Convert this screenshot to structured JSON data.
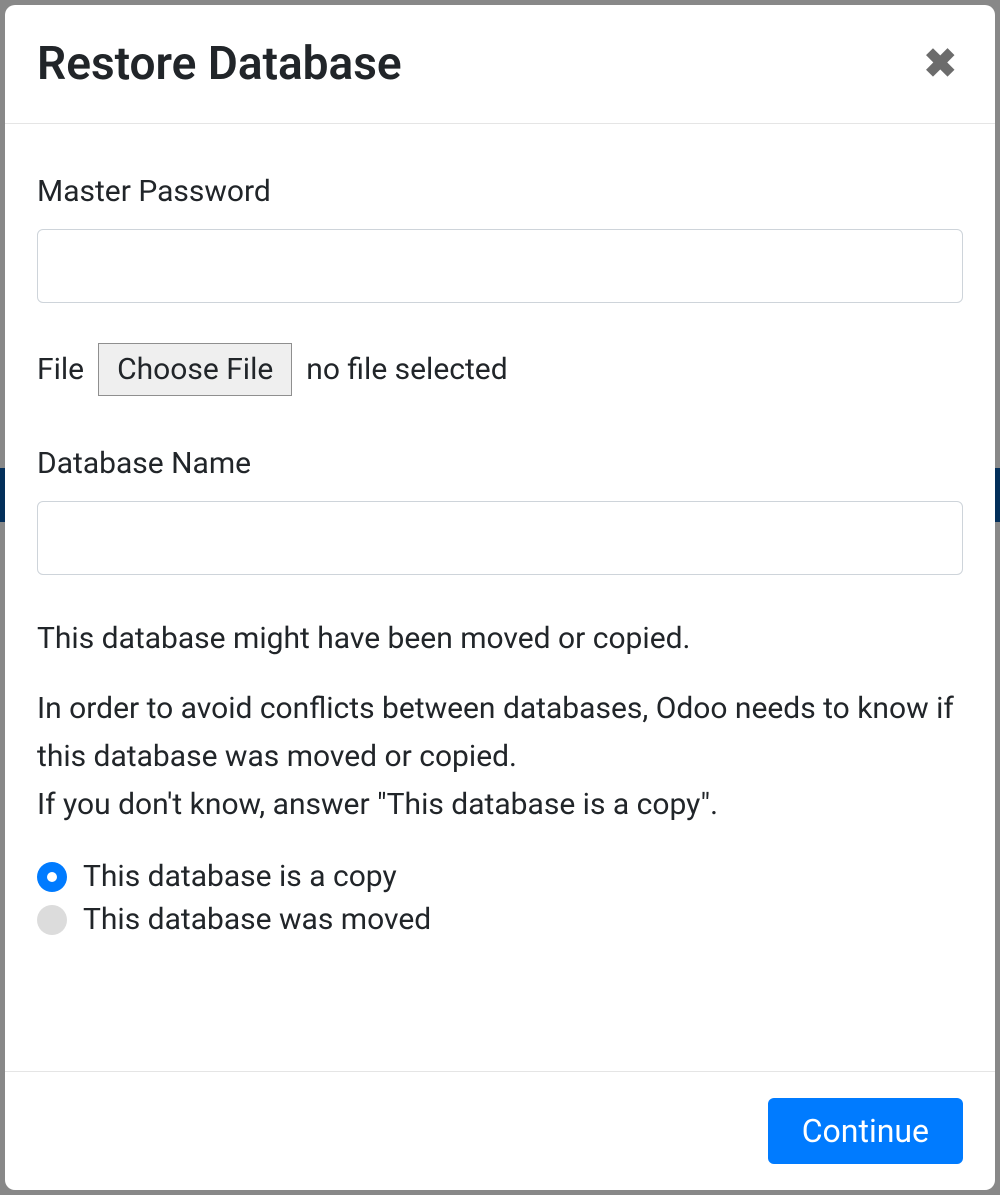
{
  "modal": {
    "title": "Restore Database",
    "close_aria": "Close"
  },
  "form": {
    "master_password": {
      "label": "Master Password",
      "value": ""
    },
    "file": {
      "label": "File",
      "button": "Choose File",
      "status": "no file selected"
    },
    "db_name": {
      "label": "Database Name",
      "value": ""
    }
  },
  "description": {
    "line1": "This database might have been moved or copied.",
    "line2": "In order to avoid conflicts between databases, Odoo needs to know if this database was moved or copied.",
    "line3": "If you don't know, answer \"This database is a copy\"."
  },
  "radio": {
    "options": [
      {
        "label": "This database is a copy",
        "checked": true
      },
      {
        "label": "This database was moved",
        "checked": false
      }
    ]
  },
  "footer": {
    "continue": "Continue"
  }
}
